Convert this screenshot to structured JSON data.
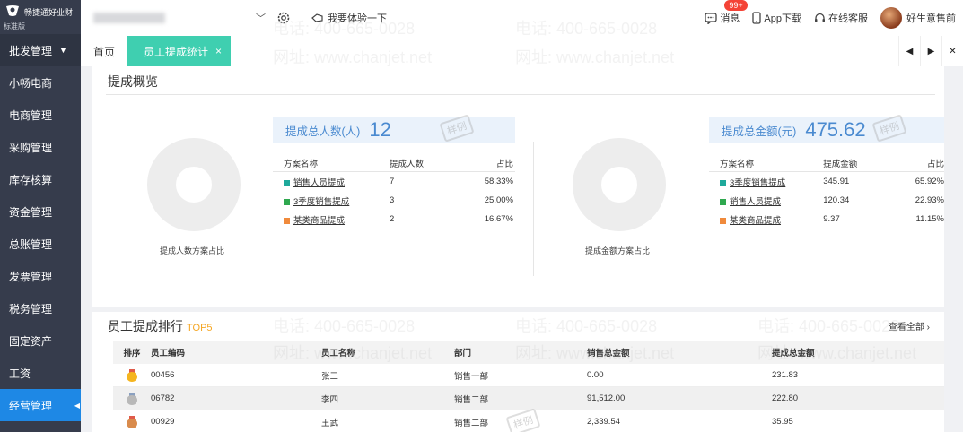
{
  "app": {
    "brand": "畅捷通好业财",
    "edition": "标准版"
  },
  "sidebar": {
    "items": [
      {
        "label": "批发管理"
      },
      {
        "label": "小畅电商"
      },
      {
        "label": "电商管理"
      },
      {
        "label": "采购管理"
      },
      {
        "label": "库存核算"
      },
      {
        "label": "资金管理"
      },
      {
        "label": "总账管理"
      },
      {
        "label": "发票管理"
      },
      {
        "label": "税务管理"
      },
      {
        "label": "固定资产"
      },
      {
        "label": "工资"
      },
      {
        "label": "经营管理"
      }
    ]
  },
  "topbar": {
    "try_label": "我要体验一下",
    "messages_label": "消息",
    "messages_badge": "99+",
    "app_download": "App下载",
    "online_service": "在线客服",
    "username": "好生意售前"
  },
  "tabs": {
    "home": "首页",
    "active": "员工提成统计",
    "close": "×"
  },
  "overview": {
    "title": "提成概览",
    "left": {
      "stat_label": "提成总人数(人)",
      "stat_value": "12",
      "donut_label": "提成人数方案占比",
      "headers": [
        "方案名称",
        "提成人数",
        "占比"
      ],
      "rows": [
        {
          "name": "销售人员提成",
          "value": "7",
          "pct": "58.33%",
          "color": "#1fa99b"
        },
        {
          "name": "3季度销售提成",
          "value": "3",
          "pct": "25.00%",
          "color": "#2fa84f"
        },
        {
          "name": "某类商品提成",
          "value": "2",
          "pct": "16.67%",
          "color": "#f08a3c"
        }
      ]
    },
    "right": {
      "stat_label": "提成总金额(元)",
      "stat_value": "475.62",
      "donut_label": "提成金额方案占比",
      "headers": [
        "方案名称",
        "提成金额",
        "占比"
      ],
      "rows": [
        {
          "name": "3季度销售提成",
          "value": "345.91",
          "pct": "65.92%",
          "color": "#1fa99b"
        },
        {
          "name": "销售人员提成",
          "value": "120.34",
          "pct": "22.93%",
          "color": "#2fa84f"
        },
        {
          "name": "某类商品提成",
          "value": "9.37",
          "pct": "11.15%",
          "color": "#f08a3c"
        }
      ]
    }
  },
  "ranking": {
    "title": "员工提成排行",
    "top": "TOP5",
    "view_all": "查看全部",
    "headers": [
      "排序",
      "员工编码",
      "员工名称",
      "部门",
      "销售总金额",
      "提成总金额"
    ],
    "rows": [
      {
        "code": "00456",
        "name": "张三",
        "dept": "销售一部",
        "sales": "0.00",
        "commission": "231.83",
        "medal": "#f5b51f"
      },
      {
        "code": "06782",
        "name": "李四",
        "dept": "销售二部",
        "sales": "91,512.00",
        "commission": "222.80",
        "medal": "#b8b8b8"
      },
      {
        "code": "00929",
        "name": "王武",
        "dept": "销售二部",
        "sales": "2,339.54",
        "commission": "35.95",
        "medal": "#d98b4c"
      }
    ]
  },
  "watermark": {
    "phone": "电话: 400-665-0028",
    "site": "网址: www.chanjet.net",
    "stamp": "样例"
  }
}
